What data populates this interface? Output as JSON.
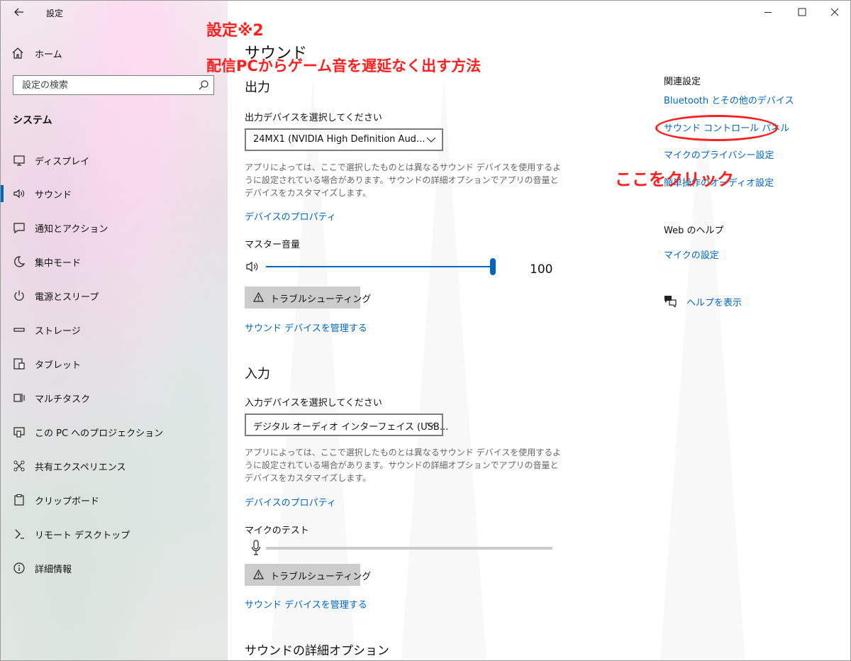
{
  "window": {
    "title": "設定",
    "back_glyph": "←",
    "controls": [
      "minimize-icon",
      "maximize-icon",
      "close-icon"
    ]
  },
  "sidebar": {
    "home_label": "ホーム",
    "search_placeholder": "設定の検索",
    "section_title": "システム",
    "items": [
      {
        "label": "ディスプレイ",
        "icon": "monitor-icon"
      },
      {
        "label": "サウンド",
        "icon": "speaker-icon",
        "active": true
      },
      {
        "label": "通知とアクション",
        "icon": "notification-icon"
      },
      {
        "label": "集中モード",
        "icon": "moon-icon"
      },
      {
        "label": "電源とスリープ",
        "icon": "power-icon"
      },
      {
        "label": "ストレージ",
        "icon": "storage-icon"
      },
      {
        "label": "タブレット",
        "icon": "tablet-icon"
      },
      {
        "label": "マルチタスク",
        "icon": "multitask-icon"
      },
      {
        "label": "この PC へのプロジェクション",
        "icon": "projection-icon"
      },
      {
        "label": "共有エクスペリエンス",
        "icon": "share-icon"
      },
      {
        "label": "クリップボード",
        "icon": "clipboard-icon"
      },
      {
        "label": "リモート デスクトップ",
        "icon": "remote-desktop-icon"
      },
      {
        "label": "詳細情報",
        "icon": "info-icon"
      }
    ]
  },
  "main": {
    "page_title": "サウンド",
    "output": {
      "heading": "出力",
      "device_label": "出力デバイスを選択してください",
      "device_value": "24MX1 (NVIDIA High Definition Aud...",
      "description": "アプリによっては、ここで選択したものとは異なるサウンド デバイスを使用するように設定されている場合があります。サウンドの詳細オプションでアプリの音量とデバイスをカスタマイズします。",
      "properties_link": "デバイスのプロパティ",
      "master_volume_label": "マスター音量",
      "volume_value": "100",
      "volume_level": 1.0,
      "troubleshoot_label": "トラブルシューティング",
      "manage_link": "サウンド デバイスを管理する"
    },
    "input": {
      "heading": "入力",
      "device_label": "入力デバイスを選択してください",
      "device_value": "デジタル オーディオ インターフェイス (USB...",
      "description": "アプリによっては、ここで選択したものとは異なるサウンド デバイスを使用するように設定されている場合があります。サウンドの詳細オプションでアプリの音量とデバイスをカスタマイズします。",
      "properties_link": "デバイスのプロパティ",
      "mic_test_label": "マイクのテスト",
      "mic_level": 0.0,
      "troubleshoot_label": "トラブルシューティング",
      "manage_link": "サウンド デバイスを管理する"
    },
    "advanced_heading": "サウンドの詳細オプション"
  },
  "related": {
    "heading": "関連設定",
    "links": [
      "Bluetooth とその他のデバイス",
      "サウンド コントロール パネル",
      "マイクのプライバシー設定",
      "簡単操作のオーディオ設定"
    ],
    "web_help_heading": "Web のヘルプ",
    "web_links": [
      "マイクの設定"
    ],
    "help_label": "ヘルプを表示"
  },
  "annotations": {
    "title_line1": "設定※2",
    "title_line2": "配信PCからゲーム音を遅延なく出す方法",
    "callout": "ここをクリック",
    "color": "#ff1f1f"
  },
  "colors": {
    "accent": "#0067c0",
    "button_bg": "#cccccc"
  }
}
